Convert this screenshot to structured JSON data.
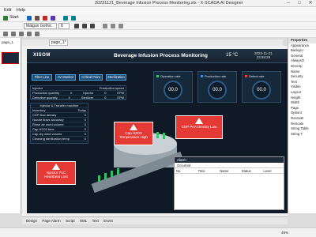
{
  "window": {
    "title": "20231121_Beverage Infusion Process Monitoring.stx - X-SCADA AI Designer",
    "minimize": "─",
    "maximize": "□",
    "close": "✕"
  },
  "menu": [
    "Edit",
    "Help"
  ],
  "toolbar": {
    "start_label": "Start",
    "font_name": "Malgun Gothic",
    "font_size": "8"
  },
  "left_panel": {
    "tab": "page_1"
  },
  "canvas_tab": "page_1*",
  "scada": {
    "logo": "XISOM",
    "title": "Beverage Infusion Process Monitoring",
    "temperature": "15 °C",
    "date": "2023-11-21",
    "time": "23:58:29",
    "nav": [
      "Filter Line",
      "AV Monitor",
      "Critical Point",
      "Sterilization"
    ],
    "kpis": [
      {
        "label": "Operation rate",
        "value": "00.0"
      },
      {
        "label": "Production rate",
        "value": "00.0"
      },
      {
        "label": "Defect rate",
        "value": "00.0"
      }
    ],
    "injector_info": {
      "header": [
        "Injector",
        "Production speed"
      ],
      "rows": [
        [
          "Production quantity",
          "0",
          "Injector",
          "0",
          "EPM"
        ],
        [
          "Defective quantity",
          "0",
          "Sterilizer",
          "0",
          "EPM"
        ]
      ]
    },
    "injector_machine": {
      "title": "Injector & Transfer machine",
      "header": [
        "Inventory",
        "Today"
      ],
      "rows": [
        [
          "CDP flow density",
          "0"
        ],
        [
          "Nozzle flows accuracy",
          "0"
        ],
        [
          "Rinse air used volume",
          "0"
        ],
        [
          "Cap H2O2 time",
          "0"
        ],
        [
          "Cap dry wind volume",
          "0"
        ],
        [
          "Cleaning sterilization temp",
          "0"
        ]
      ]
    },
    "warnings": [
      {
        "line1": "Cap H2O2",
        "line2": "Temperature High"
      },
      {
        "line1": "CDP PAA Density Low",
        "line2": ""
      },
      {
        "line1": "Injector PLC",
        "line2": "Heartbeat Lost"
      }
    ],
    "alarm": {
      "title": "Alarm",
      "filter": "Occurred",
      "columns": [
        "No",
        "Time",
        "Name",
        "Status",
        "Level"
      ]
    }
  },
  "properties": {
    "title": "Properties",
    "items": [
      "Appearance",
      "Backgro",
      "General",
      "AlwaysO",
      "Descrip",
      "Name",
      "Security",
      "Text",
      "Visible",
      "Layout",
      "Height",
      "Width",
      "Page",
      "OptionI",
      "ResizeB",
      "ReScale",
      "String Table",
      "String T"
    ]
  },
  "bottom_tabs": [
    "Design",
    "Page Alarm",
    "Script",
    "XML",
    "Text",
    "Event"
  ],
  "status": {
    "zoom": "49%"
  }
}
